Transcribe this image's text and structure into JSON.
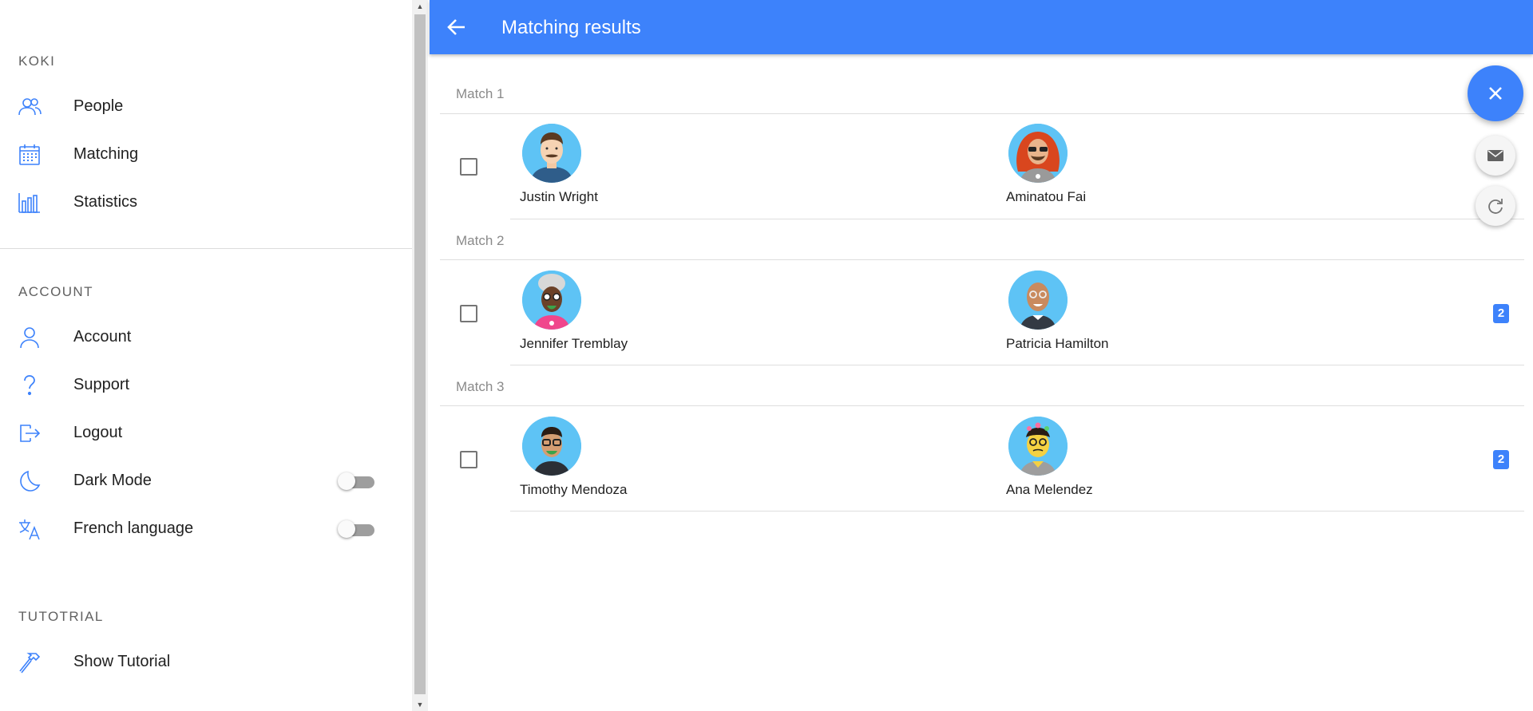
{
  "sidebar": {
    "sections": {
      "koki": "KOKI",
      "account": "ACCOUNT",
      "tutorial": "TUTOTRIAL"
    },
    "items": [
      {
        "label": "People",
        "icon": "people-icon"
      },
      {
        "label": "Matching",
        "icon": "calendar-icon"
      },
      {
        "label": "Statistics",
        "icon": "bar-chart-icon"
      },
      {
        "label": "Account",
        "icon": "person-icon"
      },
      {
        "label": "Support",
        "icon": "question-icon"
      },
      {
        "label": "Logout",
        "icon": "logout-icon"
      },
      {
        "label": "Dark Mode",
        "icon": "moon-icon",
        "toggle": false
      },
      {
        "label": "French language",
        "icon": "translate-icon",
        "toggle": false
      },
      {
        "label": "Show Tutorial",
        "icon": "hammer-icon"
      }
    ]
  },
  "header": {
    "title": "Matching results",
    "background": "#3d82fb"
  },
  "matches": [
    {
      "label": "Match 1",
      "left": "Justin Wright",
      "right": "Aminatou Fai",
      "badge": ""
    },
    {
      "label": "Match 2",
      "left": "Jennifer Tremblay",
      "right": "Patricia Hamilton",
      "badge": "2"
    },
    {
      "label": "Match 3",
      "left": "Timothy Mendoza",
      "right": "Ana Melendez",
      "badge": "2"
    }
  ],
  "fabs": {
    "main": "close-icon",
    "mail": "mail-icon",
    "refresh": "refresh-icon"
  },
  "colors": {
    "accent": "#3d82fb",
    "avatar_bg": "#5ec3f5"
  }
}
